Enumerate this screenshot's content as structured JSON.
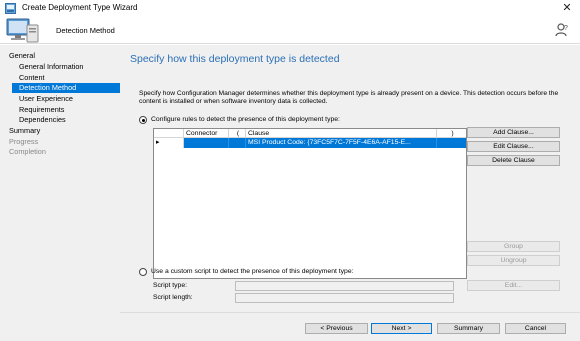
{
  "window": {
    "title": "Create Deployment Type Wizard",
    "close_glyph": "✕"
  },
  "header": {
    "title": "Detection Method"
  },
  "sidebar": {
    "items": [
      {
        "label": "General"
      },
      {
        "label": "General Information"
      },
      {
        "label": "Content"
      },
      {
        "label": "Detection Method"
      },
      {
        "label": "User Experience"
      },
      {
        "label": "Requirements"
      },
      {
        "label": "Dependencies"
      },
      {
        "label": "Summary"
      },
      {
        "label": "Progress"
      },
      {
        "label": "Completion"
      }
    ]
  },
  "main": {
    "heading": "Specify how this deployment type is detected",
    "description": "Specify how Configuration Manager determines whether this deployment type is already present on a device. This detection occurs before the content is installed or when software inventory data is collected.",
    "rules_option": "Configure rules to detect the presence of this deployment type:",
    "grid": {
      "columns": [
        "Connector",
        "(",
        "Clause",
        ")"
      ],
      "rows": [
        {
          "selector": "▸",
          "connector": "",
          "open": "",
          "clause": "MSI Product Code: {73FC5F7C-7F5F-4E6A-AF15-E...",
          "close": ""
        }
      ]
    },
    "side_buttons": {
      "add_clause": "Add Clause...",
      "edit_clause": "Edit Clause...",
      "delete_clause": "Delete Clause",
      "group": "Group",
      "ungroup": "Ungroup",
      "edit": "Edit..."
    },
    "script_option": "Use a custom script to detect the presence of this deployment type:",
    "script_type_label": "Script type:",
    "script_length_label": "Script length:"
  },
  "footer": {
    "previous": "< Previous",
    "next": "Next >",
    "summary": "Summary",
    "cancel": "Cancel"
  }
}
